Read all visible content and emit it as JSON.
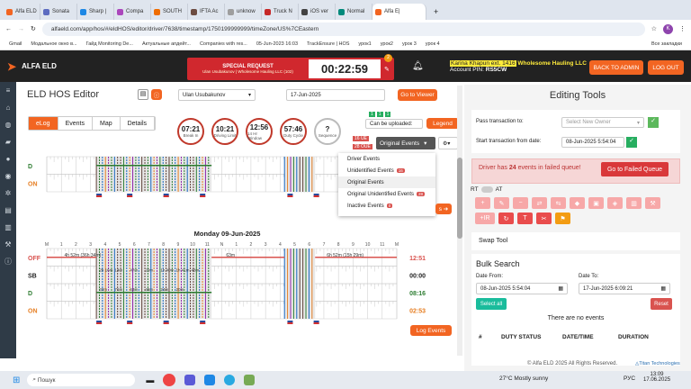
{
  "browser": {
    "tabs": [
      {
        "label": "Alfa ELD",
        "color": "#f26522"
      },
      {
        "label": "Sonata",
        "color": "#5c6bc0"
      },
      {
        "label": "Sharp |",
        "color": "#1e88e5"
      },
      {
        "label": "Compa",
        "color": "#ab47bc"
      },
      {
        "label": "SOUTH",
        "color": "#ef6c00"
      },
      {
        "label": "IFTA Ac",
        "color": "#6d4c41"
      },
      {
        "label": "unknow",
        "color": "#9e9e9e"
      },
      {
        "label": "Truck N",
        "color": "#c62828"
      },
      {
        "label": "iOS ver",
        "color": "#424242"
      },
      {
        "label": "Normal",
        "color": "#00897b"
      },
      {
        "label": "Alfa E|",
        "color": "#f26522"
      }
    ],
    "url": "alfaeld.com/app/hos/#/eldHOS/editor/driver/7638/timestamp/1750199999999/timeZone/US%7CEastern",
    "bookmarks": [
      "Gmail",
      "Модальное окно в...",
      "Гайд Monitoring De...",
      "Актуальные апдейт...",
      "Companies with res...",
      "05-Jun-2023 16:03",
      "TrackEnsure | HOS",
      "урок1",
      "урок2",
      "урок 3",
      "урок 4",
      "Все закладки"
    ]
  },
  "app": {
    "brand": "ALFA ELD",
    "special": {
      "title": "SPECIAL REQUEST",
      "sub": "Ulan Usubakunov  |  Wholesome Hauling LLC (102)",
      "timer": "00:22:59",
      "count": "2"
    },
    "account_name": "Karina Khapun ext. 1416",
    "company": "Wholesome Hauling LLC",
    "account_pin_label": "Account PIN:",
    "account_pin": "RS5CW",
    "back_admin": "BACK TO ADMIN",
    "logout": "LOG OUT"
  },
  "editor": {
    "title": "ELD HOS Editor",
    "driver": "Ulan Usubakunov",
    "date": "17-Jun-2025",
    "goto_viewer": "Go to Viewer",
    "tabs": [
      "eLog",
      "Events",
      "Map",
      "Details"
    ],
    "circles": [
      {
        "value": "07:21",
        "label": "Break In"
      },
      {
        "value": "10:21",
        "label": "Driving Limit"
      },
      {
        "value": "12:56",
        "label": "14 Hr Window"
      },
      {
        "value": "57:46",
        "label": "Duty Cycle"
      },
      {
        "value": "?",
        "label": "Sequence"
      }
    ],
    "can_upload": "Can be uploaded:",
    "legend": "Legend",
    "orig_events": "Original Events",
    "tag_16": "16 UE",
    "tag_28": "28 OUE",
    "dropdown": [
      {
        "label": "Driver Events",
        "badge": ""
      },
      {
        "label": "Unidentified Events",
        "badge": "16"
      },
      {
        "label": "Original Events",
        "badge": ""
      },
      {
        "label": "Original Unidentified Events",
        "badge": "28"
      },
      {
        "label": "Inactive Events",
        "badge": "0"
      }
    ],
    "day_title": "Monday 09-Jun-2025",
    "log_events": "Log Events",
    "hour_labels": [
      "M",
      "1",
      "2",
      "3",
      "4",
      "5",
      "6",
      "7",
      "8",
      "9",
      "10",
      "11",
      "N",
      "1",
      "2",
      "3",
      "4",
      "5",
      "6",
      "7",
      "8",
      "9",
      "10",
      "11",
      "M"
    ],
    "grid": {
      "rows": [
        "OFF",
        "SB",
        "D",
        "ON"
      ],
      "totals": [
        "12:51",
        "00:00",
        "08:16",
        "02:53"
      ],
      "row_colors": [
        "#d9534f",
        "#222",
        "#2e7d32",
        "#e67e22"
      ],
      "upper_rows": [
        "D",
        "ON"
      ],
      "annotations": [
        "4h 52m (36h 34m)",
        "63m",
        "6h 52m (15h 29m)",
        "2h 16m",
        "14m",
        "47m",
        "20m",
        "1h 40m",
        "1h 41m",
        "48m",
        "33m",
        "71m",
        "63m",
        "46m",
        "24m",
        "20m"
      ]
    }
  },
  "tools": {
    "title": "Editing Tools",
    "pass_to": "Pass transaction to:",
    "select_owner": "Select New Owner",
    "start_from": "Start transaction from date:",
    "start_date": "08-Jun-2025 5:54:04",
    "failed_pre": "Driver has ",
    "failed_count": "24",
    "failed_post": " events in failed queue!",
    "failed_btn": "Go to Failed Queue",
    "rt": "RT",
    "at": "AT",
    "swap_tool": "Swap Tool",
    "bulk_search": "Bulk Search",
    "date_from_label": "Date From:",
    "date_from": "08-Jun-2025 5:54:04",
    "date_to_label": "Date To:",
    "date_to": "17-Jun-2025 6:09:21",
    "select_all": "Select all",
    "reset": "Reset",
    "no_events": "There are no events",
    "cols": [
      "#",
      "DUTY STATUS",
      "DATE/TIME",
      "DURATION"
    ],
    "footer": "© Alfa ELD  2025 All Rights Reserved.",
    "footer2": "Titan Technologies",
    "tool_icons": [
      "plus",
      "pen",
      "dash",
      "swap",
      "arrows",
      "drop",
      "trash",
      "shield",
      "grid",
      "wrench",
      "+IR",
      "refresh",
      "T",
      "scissors",
      "bell"
    ]
  },
  "taskbar": {
    "search": "Пошук",
    "weather": "27°C  Mostly sunny",
    "lang": "РУС",
    "time": "13:09",
    "date": "17.06.2025"
  }
}
